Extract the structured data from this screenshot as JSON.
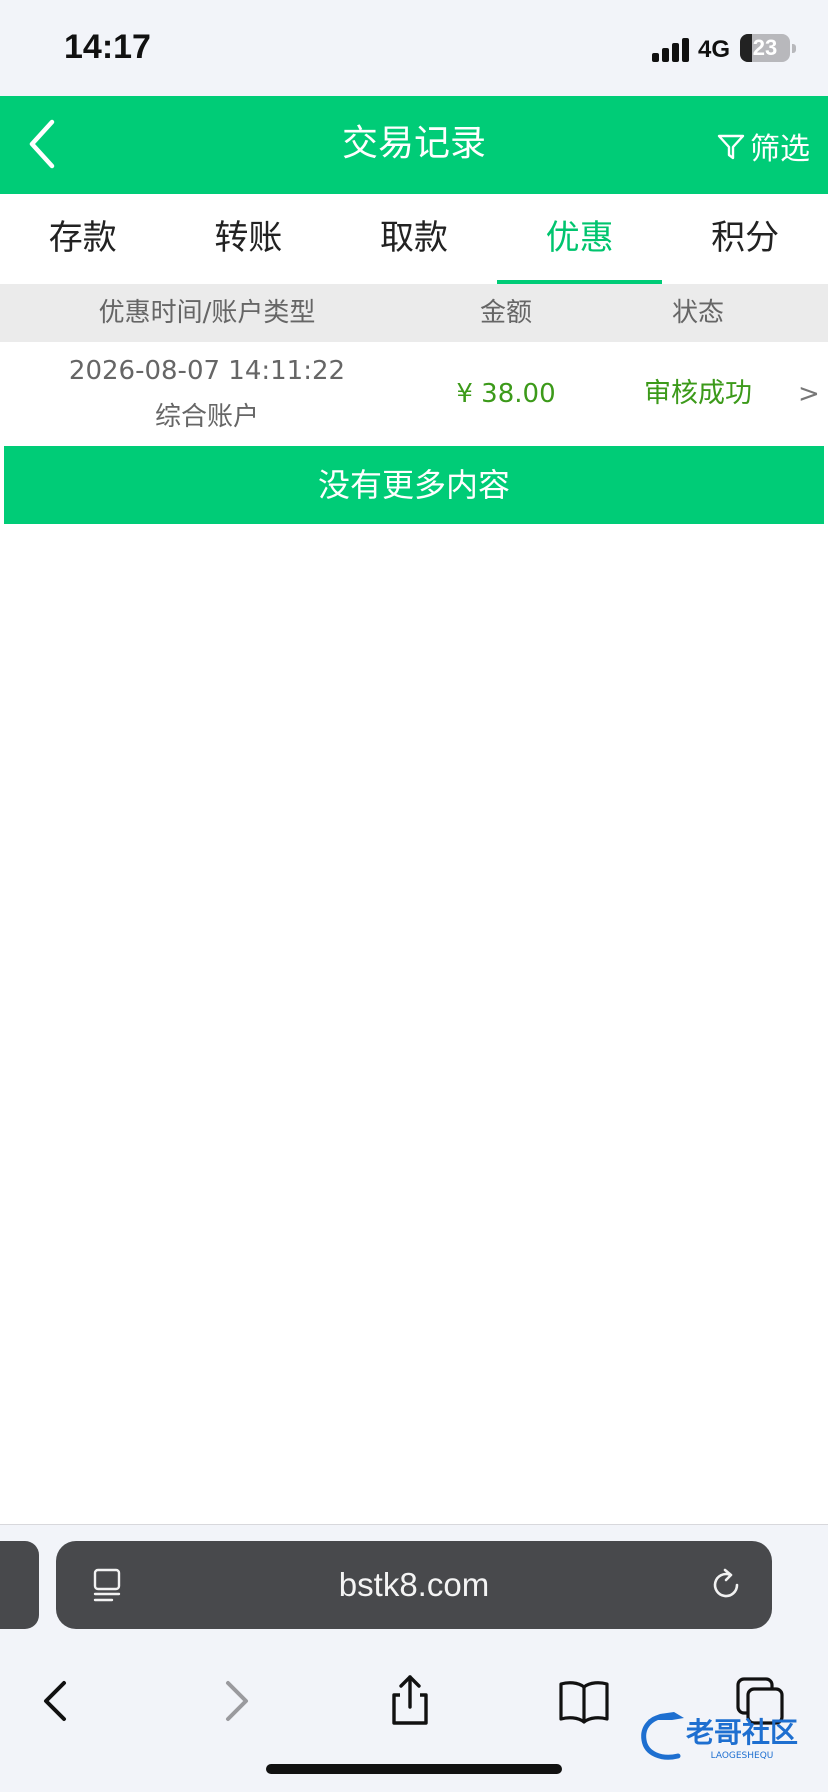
{
  "status_bar": {
    "time": "14:17",
    "network": "4G",
    "battery": "23",
    "battery_level": 0.23
  },
  "header": {
    "title": "交易记录",
    "back_icon": "chevron-left-icon",
    "filter_icon": "filter-icon",
    "filter_label": "筛选"
  },
  "tabs": [
    {
      "label": "存款",
      "active": false
    },
    {
      "label": "转账",
      "active": false
    },
    {
      "label": "取款",
      "active": false
    },
    {
      "label": "优惠",
      "active": true
    },
    {
      "label": "积分",
      "active": false
    }
  ],
  "table": {
    "columns": [
      "优惠时间/账户类型",
      "金额",
      "状态"
    ],
    "rows": [
      {
        "time": "2026-08-07 14:11:22",
        "account_type": "综合账户",
        "amount": "¥ 38.00",
        "status": "审核成功",
        "arrow": ">"
      }
    ]
  },
  "no_more": "没有更多内容",
  "browser": {
    "url": "bstk8.com",
    "url_icon": "reader-icon",
    "reload_icon": "reload-icon",
    "toolbar_icons": [
      "back-icon",
      "forward-icon",
      "share-icon",
      "bookmarks-icon",
      "tabs-icon"
    ]
  },
  "watermark": {
    "text": "老哥社区",
    "subtext": "LAOGESHEQU"
  },
  "colors": {
    "accent": "#00cc77",
    "success_text": "#3c9a1a",
    "column_header_bg": "#ebebeb"
  }
}
